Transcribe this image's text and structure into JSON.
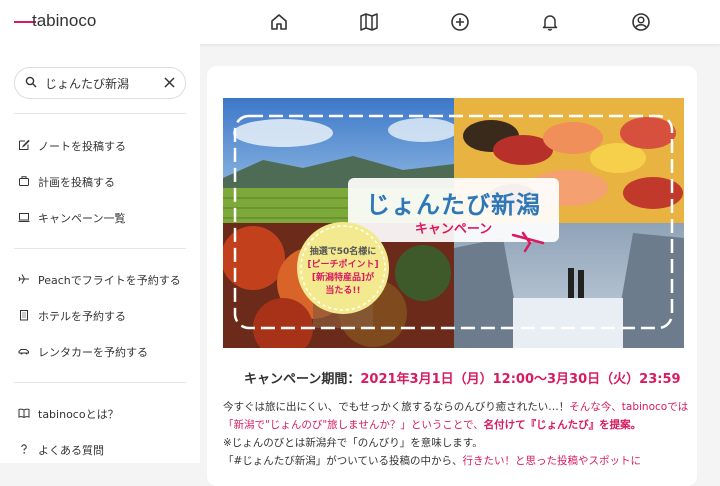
{
  "brand": {
    "name": "tabinoco",
    "accent": "#d81b60"
  },
  "nav": [
    {
      "name": "home-icon"
    },
    {
      "name": "map-icon"
    },
    {
      "name": "plus-circle-icon"
    },
    {
      "name": "bell-icon"
    },
    {
      "name": "user-icon"
    }
  ],
  "search": {
    "value": "じょんたび新潟"
  },
  "sidebar": {
    "group1": [
      "ノートを投稿する",
      "計画を投稿する",
      "キャンペーン一覧"
    ],
    "group2": [
      "Peachでフライトを予約する",
      "ホテルを予約する",
      "レンタカーを予約する"
    ],
    "group3": [
      "tabinocoとは？",
      "よくある質問"
    ]
  },
  "banner": {
    "title": "じょんたび新潟",
    "subtitle": "キャンペーン",
    "badge_l1": "抽選で50名様に",
    "badge_l2": "[ピーチポイント]",
    "badge_l3": "[新潟特産品]が",
    "badge_l4": "当たる!!"
  },
  "campaign": {
    "period_label": "キャンペーン期間：",
    "period_value": "2021年3月1日（月）12:00〜3月30日（火）23:59"
  },
  "body": {
    "l1_a": "今すぐは旅に出にくい、でもせっかく旅するならのんびり癒されたい…！",
    "l1_b": "そんな今、tabinocoでは",
    "l2_a": "「新潟で\"じょんのび\"旅しませんか？」ということで、",
    "l2_b": "名付けて『じょんたび』を提案。",
    "l3": "※じょんのびとは新潟弁で「のんびり」を意味します。",
    "l4_a": "「#じょんたび新潟」がついている投稿の中から、",
    "l4_b": "行きたい！と思った投稿やスポットに"
  }
}
